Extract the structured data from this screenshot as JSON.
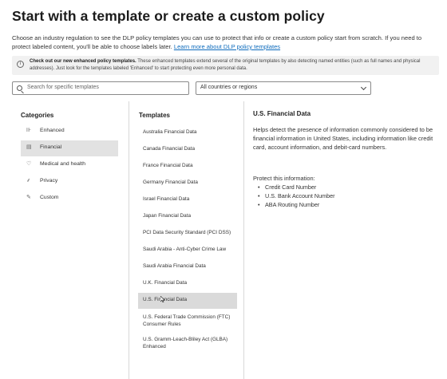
{
  "header": {
    "title": "Start with a template or create a custom policy",
    "description": "Choose an industry regulation to see the DLP policy templates you can use to protect that info or create a custom policy start from scratch. If you need to protect labeled content, you'll be able to choose labels later.",
    "learn_more_link": "Learn more about DLP policy templates"
  },
  "banner": {
    "icon": "info-icon",
    "bold_text": "Check out our new enhanced policy templates.",
    "text": " These enhanced templates extend several of the original templates by also detecting named entities (such as full names and physical addresses). Just look for the templates labeled 'Enhanced' to start protecting even more personal data."
  },
  "search": {
    "placeholder": "Search for specific templates",
    "icon": "search-icon"
  },
  "region_filter": {
    "selected": "All countries or regions",
    "icon": "chevron-down-icon"
  },
  "categories": {
    "heading": "Categories",
    "items": [
      {
        "label": "Enhanced",
        "icon": "enhanced-icon",
        "glyph": "⊪"
      },
      {
        "label": "Financial",
        "icon": "financial-icon",
        "glyph": "▤",
        "selected": true
      },
      {
        "label": "Medical and health",
        "icon": "medical-icon",
        "glyph": "♡"
      },
      {
        "label": "Privacy",
        "icon": "privacy-icon",
        "glyph": "⸙"
      },
      {
        "label": "Custom",
        "icon": "custom-icon",
        "glyph": "✎"
      }
    ]
  },
  "templates": {
    "heading": "Templates",
    "items": [
      "Australia Financial Data",
      "Canada Financial Data",
      "France Financial Data",
      "Germany Financial Data",
      "Israel Financial Data",
      "Japan Financial Data",
      "PCI Data Security Standard (PCI DSS)",
      "Saudi Arabia - Anti-Cyber Crime Law",
      "Saudi Arabia Financial Data",
      "U.K. Financial Data",
      "U.S. Financial Data",
      "U.S. Federal Trade Commission (FTC) Consumer Rules",
      "U.S. Gramm-Leach-Bliley Act (GLBA) Enhanced"
    ],
    "selected": "U.S. Financial Data"
  },
  "details": {
    "title": "U.S. Financial Data",
    "description": "Helps detect the presence of information commonly considered to be financial information in United States, including information like credit card, account information, and debit-card numbers.",
    "protect_heading": "Protect this information:",
    "protect_items": [
      "Credit Card Number",
      "U.S. Bank Account Number",
      "ABA Routing Number"
    ]
  },
  "colors": {
    "link": "#0f6cbd",
    "selected_bg": "#e2e2e2",
    "banner_bg": "#f1f1f1"
  }
}
